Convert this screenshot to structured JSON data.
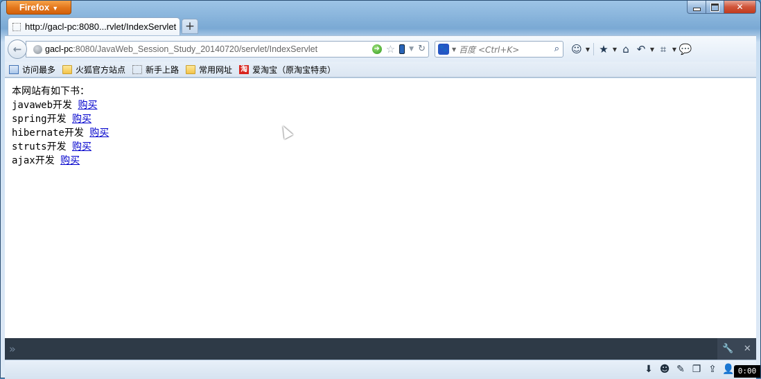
{
  "window": {
    "app_button": "Firefox",
    "controls": {
      "minimize": "minimize",
      "maximize": "maximize",
      "close": "✕"
    }
  },
  "tab": {
    "title": "http://gacl-pc:8080...rvlet/IndexServlet",
    "new_tab_label": "+"
  },
  "navbar": {
    "url_host": "gacl-pc",
    "url_rest": ":8080/JavaWeb_Session_Study_20140720/servlet/IndexServlet",
    "search_engine": "baidu-icon",
    "search_placeholder": "百度 <Ctrl+K>"
  },
  "bookmarks": [
    {
      "label": "访问最多",
      "icon": "list-icon"
    },
    {
      "label": "火狐官方站点",
      "icon": "folder-icon"
    },
    {
      "label": "新手上路",
      "icon": "page-icon"
    },
    {
      "label": "常用网址",
      "icon": "folder-icon"
    },
    {
      "label": "爱淘宝（原淘宝特卖）",
      "icon": "taobao-icon",
      "icon_text": "淘"
    }
  ],
  "page": {
    "heading": "本网站有如下书：",
    "books": [
      {
        "name": "javaweb开发",
        "link": "购买"
      },
      {
        "name": "spring开发",
        "link": "购买"
      },
      {
        "name": "hibernate开发",
        "link": "购买"
      },
      {
        "name": "struts开发",
        "link": "购买"
      },
      {
        "name": "ajax开发",
        "link": "购买"
      }
    ]
  },
  "console": {
    "prompt": "»",
    "close": "✕"
  },
  "status": {
    "timer": "0:00"
  },
  "colors": {
    "link": "#0000cc",
    "firefox_orange": "#e2751b",
    "console_bg": "#2e3a47"
  }
}
